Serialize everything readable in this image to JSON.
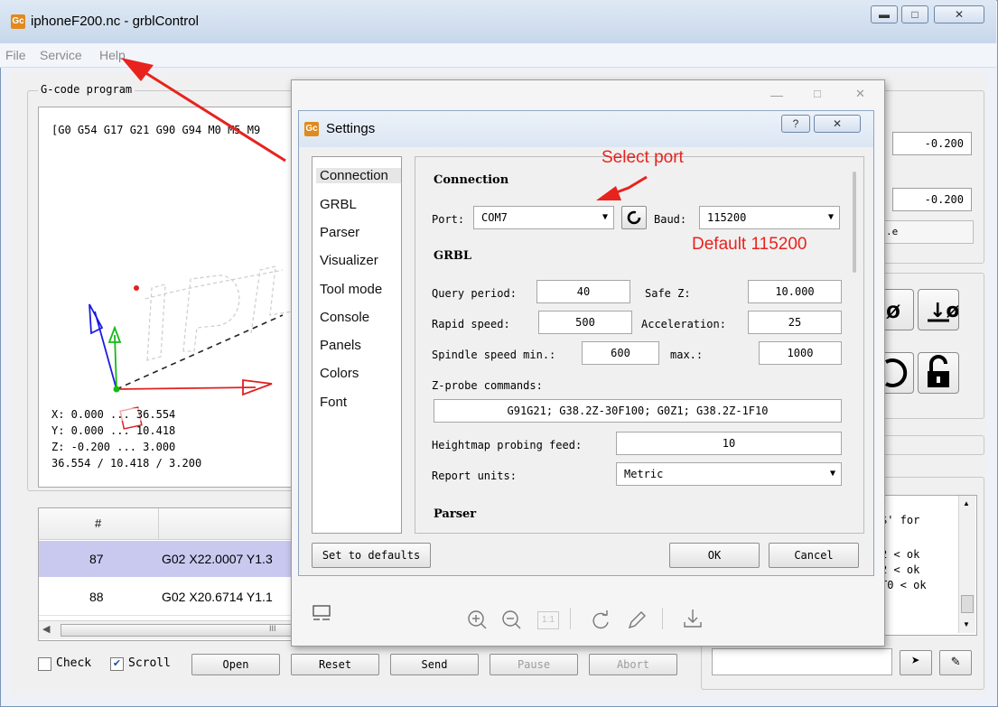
{
  "window": {
    "title": "iphoneF200.nc - grblControl",
    "icon_text": "Gc"
  },
  "menu": [
    {
      "label": "File"
    },
    {
      "label": "Service"
    },
    {
      "label": "Help"
    }
  ],
  "gcode_panel": {
    "label": "G-code program",
    "first_line": "[G0 G54 G17 G21 G90 G94 M0 M5 M9",
    "coords": [
      "X: 0.000 ... 36.554",
      "Y: 0.000 ... 10.418",
      "Z: -0.200 ... 3.000",
      "36.554 / 10.418 / 3.200"
    ],
    "table_header": "#",
    "rows": [
      {
        "num": "87",
        "code": "G02 X22.0007 Y1.3"
      },
      {
        "num": "88",
        "code": "G02 X20.6714 Y1.1"
      }
    ],
    "scrollbar_grip": "III"
  },
  "bottom_bar": {
    "check": "Check",
    "scroll": "Scroll",
    "open": "Open",
    "reset": "Reset",
    "send": "Send",
    "pause": "Pause",
    "abort": "Abort"
  },
  "right_panel": {
    "value1": "-0.200",
    "value2": "-0.200",
    "partial_btn": ".e",
    "console_lines": [
      "$' for",
      "2 < ok",
      "2 < ok",
      "T0 < ok"
    ]
  },
  "settings": {
    "title": "Settings",
    "help_glyph": "?",
    "close_glyph": "✕",
    "nav": [
      "Connection",
      "GRBL",
      "Parser",
      "Visualizer",
      "Tool mode",
      "Console",
      "Panels",
      "Colors",
      "Font"
    ],
    "connection": {
      "heading": "Connection",
      "port_label": "Port:",
      "port_value": "COM7",
      "baud_label": "Baud:",
      "baud_value": "115200"
    },
    "grbl": {
      "heading": "GRBL",
      "query_period_label": "Query period:",
      "query_period": "40",
      "safe_z_label": "Safe Z:",
      "safe_z": "10.000",
      "rapid_speed_label": "Rapid speed:",
      "rapid_speed": "500",
      "acceleration_label": "Acceleration:",
      "acceleration": "25",
      "spindle_min_label": "Spindle speed min.:",
      "spindle_min": "600",
      "spindle_max_label": "max.:",
      "spindle_max": "1000",
      "zprobe_label": "Z-probe commands:",
      "zprobe": "G91G21; G38.2Z-30F100; G0Z1; G38.2Z-1F10",
      "heightmap_label": "Heightmap probing feed:",
      "heightmap": "10",
      "units_label": "Report units:",
      "units": "Metric"
    },
    "parser_heading": "Parser",
    "buttons": {
      "defaults": "Set to defaults",
      "ok": "OK",
      "cancel": "Cancel"
    }
  },
  "annotations": {
    "select_port": "Select port",
    "default_baud": "Default 115200"
  },
  "colors": {
    "annotation": "#e8231d",
    "selected_row": "#c9c9f0"
  }
}
